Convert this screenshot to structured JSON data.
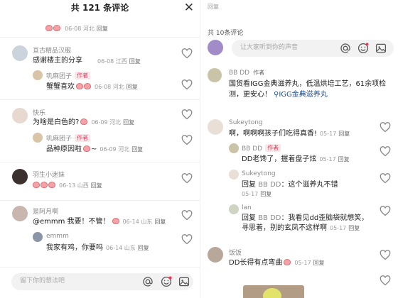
{
  "left": {
    "title": "共 121 条评论",
    "top_meta": {
      "date": "06-08",
      "loc": "河北",
      "reply": "回复"
    },
    "comments": [
      {
        "name": "亘古精品汉服",
        "text": "感谢楼主的分享",
        "date": "06-08",
        "loc": "江西",
        "reply": "回复",
        "sub": {
          "name": "叽麻团子",
          "badge": "作者",
          "text": "蟹蟹喜欢",
          "date": "06-08",
          "loc": "河北",
          "reply": "回复"
        }
      },
      {
        "name": "快乐",
        "text": "为啥是白色的?",
        "date": "06-09",
        "loc": "河北",
        "reply": "回复",
        "sub": {
          "name": "叽麻团子",
          "badge": "作者",
          "text": "品种原因啦",
          "tail": "~",
          "date": "06-09",
          "loc": "河北",
          "reply": "回复"
        }
      },
      {
        "name": "羽生小迷妹",
        "date": "06-13",
        "loc": "山西",
        "reply": "回复"
      },
      {
        "name": "是阿月啊",
        "text": "@emmm 我要！不管！",
        "date": "06-14",
        "loc": "山东",
        "reply": "回复",
        "sub": {
          "name": "emmm",
          "text": "我家有鸡，你要吗",
          "date": "06-14",
          "loc": "山东",
          "reply": "回复"
        }
      }
    ],
    "input_placeholder": "留下你的想法吧"
  },
  "right": {
    "top_text": "回复",
    "count": "共 10条评论",
    "input_placeholder": "让大家听到你的声音",
    "comments": [
      {
        "name": "BB DD",
        "badge": "作者",
        "text1": "国货看IGG金典滋养丸，低温烘培工艺，61余项检",
        "text2": "测，更安心！",
        "link": "IGG金典滋养丸"
      },
      {
        "name": "Sukeytong",
        "text": "啊，啊啊啊孩子们吃得真香!",
        "date": "05-17",
        "reply": "回复",
        "subs": [
          {
            "name": "BB DD",
            "badge": "作者",
            "text": "DD老馋了，握着盘子炫",
            "date": "05-17",
            "reply": "回复"
          },
          {
            "name": "Sukeytong",
            "reply_label": "回复",
            "target": "BB DD",
            "text": "：这个滋养丸不错",
            "date": "05-17",
            "reply": "回复"
          },
          {
            "name": "lan",
            "reply_label": "回复",
            "target": "BB DD",
            "text": "：我看见dd歪脑袋就想笑，",
            "text2": "寻思着，别的玄凤不这样啊",
            "date": "05-17",
            "reply": "回复"
          }
        ]
      },
      {
        "name": "饭饭",
        "text": "DD长得有点弯曲",
        "date": "05-17",
        "reply": "回复"
      }
    ]
  },
  "colors": {
    "accent": "#fe2c55",
    "link": "#1d4f91",
    "input_bg": "#f2f2f2"
  },
  "icons": [
    "close-icon",
    "heart-icon",
    "at-icon",
    "emoji-icon",
    "image-icon",
    "search-icon"
  ]
}
